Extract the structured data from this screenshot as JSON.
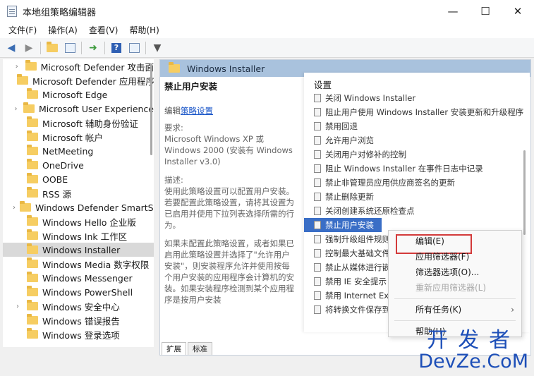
{
  "window": {
    "title": "本地组策略编辑器",
    "controls": [
      "—",
      "☐",
      "✕"
    ]
  },
  "menu": [
    "文件(F)",
    "操作(A)",
    "查看(V)",
    "帮助(H)"
  ],
  "toolbar": {
    "icons": [
      "back-arrow-icon",
      "forward-arrow-icon",
      "up-folder-icon",
      "show-hide-tree-icon",
      "export-list-icon",
      "help-icon",
      "properties-icon",
      "filter-icon"
    ],
    "help_label": "?"
  },
  "tree": {
    "items": [
      {
        "label": "Microsoft Defender 攻击面",
        "expandable": true
      },
      {
        "label": "Microsoft Defender 应用程序",
        "expandable": false
      },
      {
        "label": "Microsoft Edge",
        "expandable": false
      },
      {
        "label": "Microsoft User Experience",
        "expandable": true
      },
      {
        "label": "Microsoft 辅助身份验证",
        "expandable": false
      },
      {
        "label": "Microsoft 帐户",
        "expandable": false
      },
      {
        "label": "NetMeeting",
        "expandable": false
      },
      {
        "label": "OneDrive",
        "expandable": false
      },
      {
        "label": "OOBE",
        "expandable": false
      },
      {
        "label": "RSS 源",
        "expandable": false
      },
      {
        "label": "Windows Defender SmartScreen",
        "expandable": true
      },
      {
        "label": "Windows Hello 企业版",
        "expandable": false
      },
      {
        "label": "Windows Ink 工作区",
        "expandable": false
      },
      {
        "label": "Windows Installer",
        "expandable": false,
        "selected": true
      },
      {
        "label": "Windows Media 数字权限",
        "expandable": false
      },
      {
        "label": "Windows Messenger",
        "expandable": false
      },
      {
        "label": "Windows PowerShell",
        "expandable": false
      },
      {
        "label": "Windows 安全中心",
        "expandable": true
      },
      {
        "label": "Windows 错误报告",
        "expandable": false
      },
      {
        "label": "Windows 登录选项",
        "expandable": false
      }
    ]
  },
  "right_pane": {
    "header": "Windows Installer",
    "description": {
      "title": "禁止用户安装",
      "edit_prefix": "编辑",
      "edit_link": "策略设置",
      "requirements_label": "要求:",
      "requirements_text": "Microsoft Windows XP 或 Windows 2000 (安装有 Windows Installer v3.0)",
      "desc_label": "描述:",
      "desc_text": "使用此策略设置可以配置用户安装。若要配置此策略设置，请将其设置为已启用并使用下拉列表选择所需的行为。",
      "desc_text2": "如果未配置此策略设置，或者如果已启用此策略设置并选择了\"允许用户安装\"，则安装程序允许并使用按每个用户安装的应用程序会计算机的安装。如果安装程序检测到某个应用程序是按用户安装"
    },
    "list": {
      "header": "设置",
      "rows": [
        "关闭 Windows Installer",
        "阻止用户使用 Windows Installer 安装更新和升级程序",
        "禁用回退",
        "允许用户浏览",
        "关闭用户对修补的控制",
        "阻止 Windows Installer 在事件日志中记录",
        "禁止非管理员应用供应商签名的更新",
        "禁止删除更新",
        "关闭创建系统还原检查点",
        "禁止用户安装",
        "强制升级组件规则",
        "控制最大基础文件大小",
        "禁止从媒体进行嵌入式 UI",
        "禁用 IE 安全提示",
        "禁用 Internet Explorer",
        "将转换文件保存到..."
      ],
      "highlighted_index": 9
    },
    "tabs": [
      "扩展",
      "标准"
    ]
  },
  "context_menu": {
    "items": [
      {
        "label": "编辑(E)",
        "boxed": true
      },
      {
        "label": "应用筛选器(F)"
      },
      {
        "label": "筛选器选项(O)..."
      },
      {
        "label": "重新应用筛选器(L)",
        "disabled": true
      },
      {
        "label": "所有任务(K)",
        "submenu": true
      },
      {
        "label": "帮助(H)"
      }
    ],
    "submenu_arrow": "›"
  },
  "watermark": {
    "cn": "开发者",
    "en": "DevZe.CoM"
  }
}
